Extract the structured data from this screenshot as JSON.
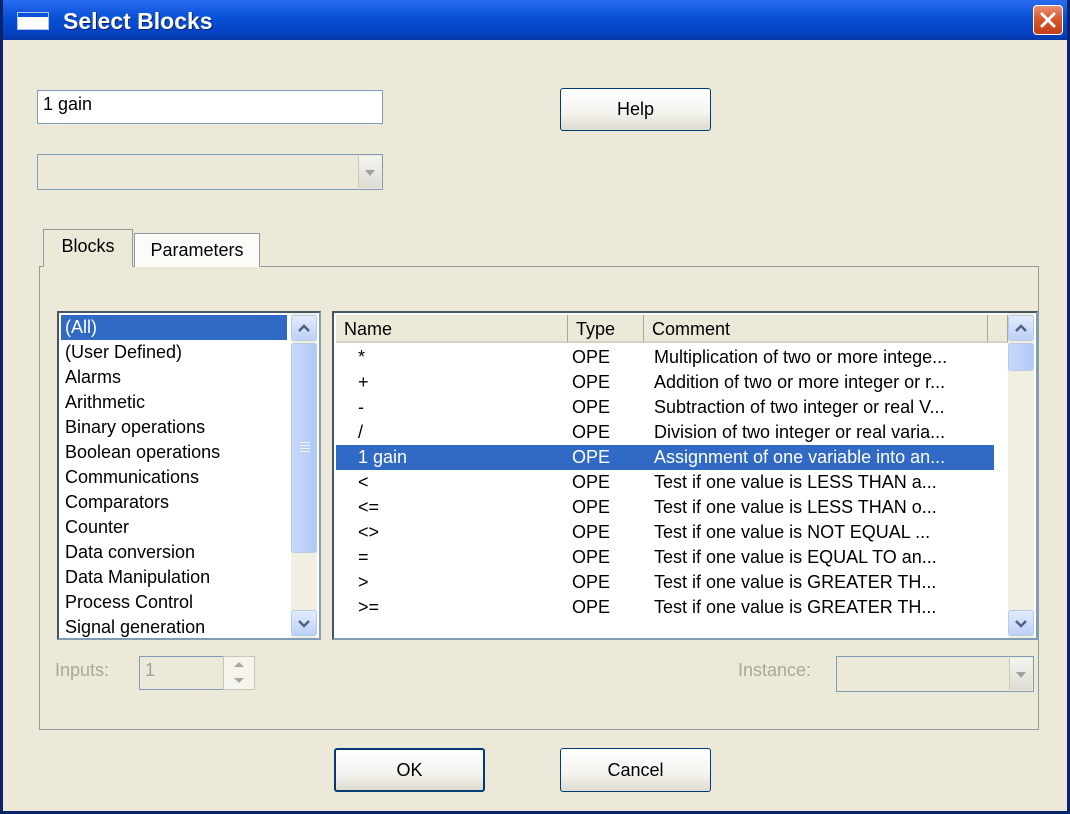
{
  "window": {
    "title": "Select Blocks",
    "close_glyph": "close-icon"
  },
  "search": {
    "value": "1 gain"
  },
  "help_button": "Help",
  "dropdown": {
    "value": ""
  },
  "tabs": [
    {
      "label": "Blocks",
      "active": true
    },
    {
      "label": "Parameters",
      "active": false
    }
  ],
  "categories": {
    "items": [
      "(All)",
      "(User Defined)",
      "Alarms",
      "Arithmetic",
      "Binary operations",
      "Boolean operations",
      "Communications",
      "Comparators",
      "Counter",
      "Data conversion",
      "Data Manipulation",
      "Process Control",
      "Signal generation"
    ],
    "selected": 0
  },
  "blocks": {
    "columns": [
      "Name",
      "Type",
      "Comment"
    ],
    "rows": [
      {
        "name": "*",
        "type": "OPE",
        "comment": "Multiplication of two or more intege..."
      },
      {
        "name": "+",
        "type": "OPE",
        "comment": "Addition of two or more integer or r..."
      },
      {
        "name": "-",
        "type": "OPE",
        "comment": "Subtraction of two integer or real V..."
      },
      {
        "name": "/",
        "type": "OPE",
        "comment": "Division of two integer or real varia..."
      },
      {
        "name": "1 gain",
        "type": "OPE",
        "comment": "Assignment of one variable into an..."
      },
      {
        "name": "<",
        "type": "OPE",
        "comment": "Test if one value is LESS THAN a..."
      },
      {
        "name": "<=",
        "type": "OPE",
        "comment": "Test if one value is LESS THAN o..."
      },
      {
        "name": "<>",
        "type": "OPE",
        "comment": "Test if one value is NOT EQUAL ..."
      },
      {
        "name": "=",
        "type": "OPE",
        "comment": "Test if one value is EQUAL TO an..."
      },
      {
        "name": ">",
        "type": "OPE",
        "comment": "Test if one value is GREATER TH..."
      },
      {
        "name": ">=",
        "type": "OPE",
        "comment": "Test if one value is GREATER TH..."
      }
    ],
    "selected": 4
  },
  "inputs": {
    "label": "Inputs:",
    "value": "1"
  },
  "instance": {
    "label": "Instance:",
    "value": ""
  },
  "footer": {
    "ok": "OK",
    "cancel": "Cancel"
  }
}
